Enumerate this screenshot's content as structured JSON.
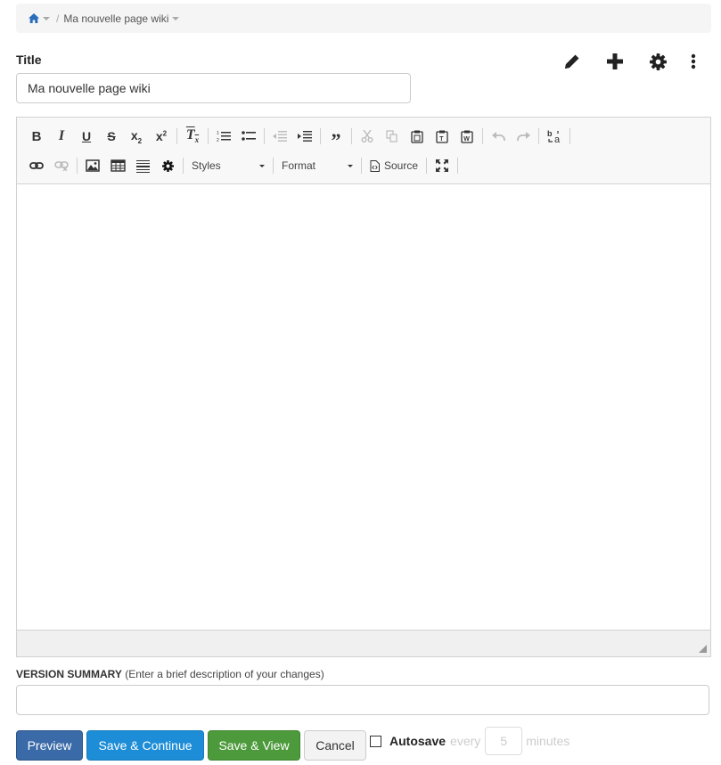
{
  "breadcrumb": {
    "home_icon": "home-icon",
    "separator": "/",
    "current_page": "Ma nouvelle page wiki"
  },
  "title": {
    "label": "Title",
    "value": "Ma nouvelle page wiki"
  },
  "actions": [
    "pencil-icon",
    "plus-icon",
    "gear-icon",
    "vertical-dots-icon"
  ],
  "editor": {
    "toolbar_row1": [
      "bold",
      "italic",
      "underline",
      "strikethrough",
      "subscript",
      "superscript",
      "remove-format",
      "numbered-list",
      "bulleted-list",
      "decrease-indent",
      "increase-indent",
      "blockquote",
      "cut",
      "copy",
      "paste",
      "paste-as-text",
      "paste-from-word",
      "undo",
      "redo",
      "find-replace"
    ],
    "toolbar_row2": [
      "link",
      "unlink",
      "image",
      "table",
      "horizontal-line",
      "plugin-settings"
    ],
    "styles_label": "Styles",
    "format_label": "Format",
    "source_label": "Source",
    "content": ""
  },
  "version_summary": {
    "label": "VERSION SUMMARY",
    "hint": "(Enter a brief description of your changes)",
    "value": ""
  },
  "buttons": {
    "preview": "Preview",
    "save_continue": "Save & Continue",
    "save_view": "Save & View",
    "cancel": "Cancel"
  },
  "autosave": {
    "label": "Autosave",
    "checked": false,
    "every": "every",
    "interval": "5",
    "unit": "minutes"
  },
  "colors": {
    "preview_bg": "#3a6aa8",
    "save_continue_bg": "#1c8dd6",
    "save_view_bg": "#4d9a3c",
    "link_blue": "#2a6ebb"
  }
}
